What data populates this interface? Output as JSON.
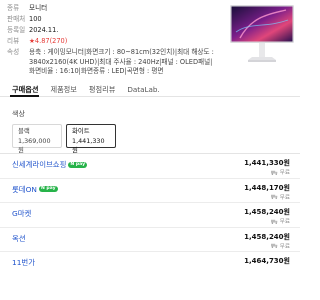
{
  "info": {
    "category": {
      "key": "종류",
      "value": "모니터"
    },
    "spec_count": {
      "key": "판매처",
      "value": "100"
    },
    "registered": {
      "key": "등록일",
      "value": "2024.11."
    },
    "review": {
      "key": "리뷰",
      "value": "★4.87(270)"
    },
    "attributes": {
      "key": "속성",
      "value": "용축 : 게이밍모니터|화면크기 : 80~81cm(32인치)|최대 해상도 : 3840x2160(4K UHD)|최대 주사율 : 240Hz|패널 : OLED패널|화면비율 : 16:10|화면종류 : LED|곡면형 : 평면"
    }
  },
  "tabs": [
    {
      "label": "구매옵션",
      "active": true
    },
    {
      "label": "제품정보",
      "active": false
    },
    {
      "label": "평점리뷰",
      "active": false
    },
    {
      "label": "DataLab.",
      "active": false
    }
  ],
  "color_label": "색상",
  "options": [
    {
      "name": "블랙",
      "price": "1,369,000원",
      "selected": false
    },
    {
      "name": "화이트",
      "price": "1,441,330원",
      "selected": true
    }
  ],
  "sellers": [
    {
      "shop": "신세계라이브쇼핑",
      "badge": "N pay",
      "price": "1,441,330원",
      "shipping": "무료"
    },
    {
      "shop": "롯데ON",
      "badge": "N pay",
      "price": "1,448,170원",
      "shipping": "무료"
    },
    {
      "shop": "G마켓",
      "badge": "",
      "price": "1,458,240원",
      "shipping": "무료"
    },
    {
      "shop": "옥션",
      "badge": "",
      "price": "1,458,240원",
      "shipping": "무료"
    },
    {
      "shop": "11번가",
      "badge": "",
      "price": "1,464,730원",
      "shipping": ""
    }
  ],
  "colors": {
    "link": "#2255cc",
    "rating": "#e53935",
    "npay": "#27b34a"
  }
}
